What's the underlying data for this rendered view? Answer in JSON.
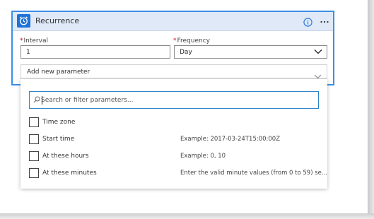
{
  "card": {
    "title": "Recurrence",
    "icon": "alarm-clock-icon",
    "accent": "#3a8ee6"
  },
  "fields": {
    "interval": {
      "required_mark": "*",
      "label": "Interval",
      "value": "1"
    },
    "frequency": {
      "required_mark": "*",
      "label": "Frequency",
      "value": "Day"
    }
  },
  "add_parameter": {
    "label": "Add new parameter"
  },
  "dropdown": {
    "search_placeholder": "Search or filter parameters...",
    "items": [
      {
        "label": "Time zone",
        "hint": "",
        "checked": false
      },
      {
        "label": "Start time",
        "hint": "Example: 2017-03-24T15:00:00Z",
        "checked": false
      },
      {
        "label": "At these hours",
        "hint": "Example: 0, 10",
        "checked": false
      },
      {
        "label": "At these minutes",
        "hint": "Enter the valid minute values (from 0 to 59) se...",
        "checked": false
      }
    ]
  }
}
